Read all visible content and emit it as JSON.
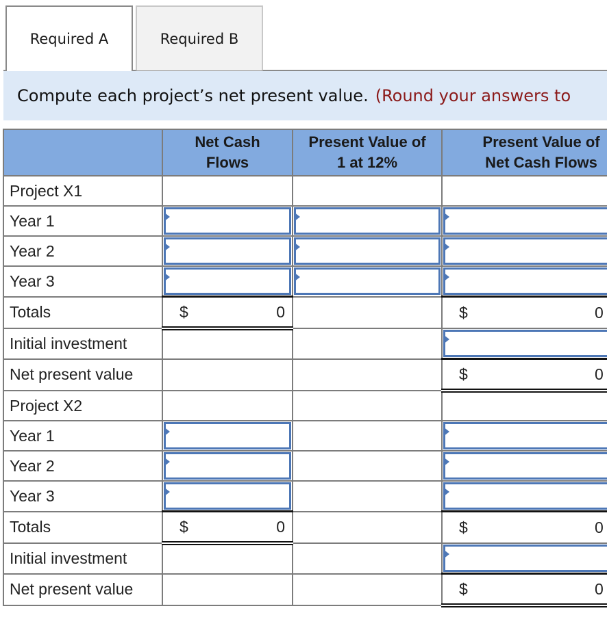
{
  "tabs": [
    {
      "label": "Required A",
      "active": true
    },
    {
      "label": "Required B",
      "active": false
    }
  ],
  "instruction": {
    "text": "Compute each project’s net present value.",
    "note": "(Round your answers to"
  },
  "table": {
    "headers": {
      "label": "",
      "net_cash_flows_line1": "Net Cash",
      "net_cash_flows_line2": "Flows",
      "pv_factor_line1": "Present Value of",
      "pv_factor_line2": "1 at 12%",
      "pv_net_line1": "Present Value of",
      "pv_net_line2": "Net Cash Flows"
    },
    "rows": [
      {
        "label": "Project X1"
      },
      {
        "label": "Year 1",
        "net_cash_flows": "",
        "pv_factor": "",
        "pv_net": ""
      },
      {
        "label": "Year 2",
        "net_cash_flows": "",
        "pv_factor": "",
        "pv_net": ""
      },
      {
        "label": "Year 3",
        "net_cash_flows": "",
        "pv_factor": "",
        "pv_net": ""
      },
      {
        "label": "Totals",
        "currency": "$",
        "net_cash_flows_total": "0",
        "pv_net_total": "0"
      },
      {
        "label": "Initial investment",
        "pv_net": ""
      },
      {
        "label": "Net present value",
        "currency": "$",
        "pv_net_total": "0"
      },
      {
        "label": "Project X2"
      },
      {
        "label": "Year 1",
        "net_cash_flows": "",
        "pv_net": ""
      },
      {
        "label": "Year 2",
        "net_cash_flows": "",
        "pv_net": ""
      },
      {
        "label": "Year 3",
        "net_cash_flows": "",
        "pv_net": ""
      },
      {
        "label": "Totals",
        "currency": "$",
        "net_cash_flows_total": "0",
        "pv_net_total": "0"
      },
      {
        "label": "Initial investment",
        "pv_net": ""
      },
      {
        "label": "Net present value",
        "currency": "$",
        "pv_net_total": "0"
      }
    ]
  },
  "colors": {
    "header_bg": "#82aadf",
    "input_border": "#4d77b6",
    "banner_bg": "#dde9f7",
    "note_text": "#8b1a1a"
  }
}
